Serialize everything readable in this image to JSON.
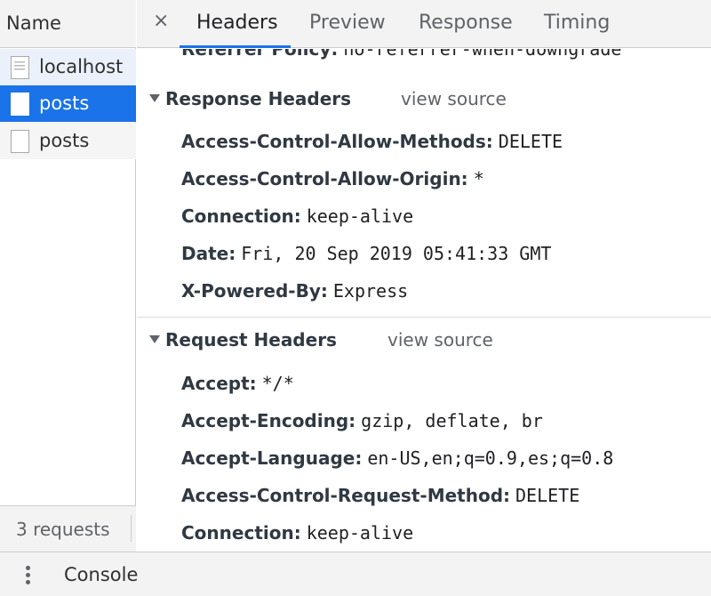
{
  "left_panel": {
    "header": "Name",
    "requests": [
      {
        "name": "localhost",
        "icon": "document-icon",
        "selected": false
      },
      {
        "name": "posts",
        "icon": "file-icon",
        "selected": true
      },
      {
        "name": "posts",
        "icon": "file-icon",
        "selected": false
      }
    ],
    "footer": "3 requests"
  },
  "tabs": {
    "close": "×",
    "items": [
      "Headers",
      "Preview",
      "Response",
      "Timing"
    ],
    "active": "Headers"
  },
  "general": {
    "partial_row": {
      "key": "Referrer Policy:",
      "value": "no-referrer-when-downgrade"
    }
  },
  "response_headers": {
    "title": "Response Headers",
    "view_source": "view source",
    "rows": [
      {
        "key": "Access-Control-Allow-Methods:",
        "value": "DELETE"
      },
      {
        "key": "Access-Control-Allow-Origin:",
        "value": "*"
      },
      {
        "key": "Connection:",
        "value": "keep-alive"
      },
      {
        "key": "Date:",
        "value": "Fri, 20 Sep 2019 05:41:33 GMT"
      },
      {
        "key": "X-Powered-By:",
        "value": "Express"
      }
    ]
  },
  "request_headers": {
    "title": "Request Headers",
    "view_source": "view source",
    "rows": [
      {
        "key": "Accept:",
        "value": "*/*"
      },
      {
        "key": "Accept-Encoding:",
        "value": "gzip, deflate, br"
      },
      {
        "key": "Accept-Language:",
        "value": "en-US,en;q=0.9,es;q=0.8"
      },
      {
        "key": "Access-Control-Request-Method:",
        "value": "DELETE"
      },
      {
        "key": "Connection:",
        "value": "keep-alive"
      }
    ]
  },
  "drawer": {
    "menu_icon": "kebab-menu-icon",
    "console_label": "Console"
  },
  "colors": {
    "selection": "#1a73e8",
    "hover_row": "#eaf1fb",
    "toolbar_bg": "#f3f3f3"
  }
}
